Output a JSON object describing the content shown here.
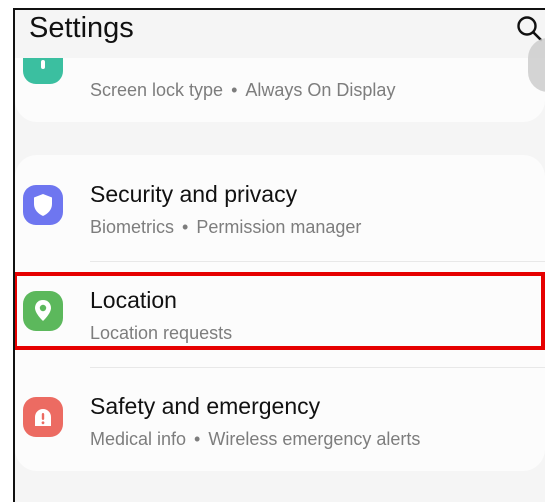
{
  "header": {
    "title": "Settings",
    "search_icon": "search-icon"
  },
  "lock_screen": {
    "subtitle_parts": [
      "Screen lock type",
      "Always On Display"
    ],
    "icon": "lock-icon",
    "icon_color": "#3bbfa0"
  },
  "items": [
    {
      "title": "Security and privacy",
      "subtitle_parts": [
        "Biometrics",
        "Permission manager"
      ],
      "icon": "shield-icon",
      "icon_color": "#6e76f0"
    },
    {
      "title": "Location",
      "subtitle_parts": [
        "Location requests"
      ],
      "icon": "location-pin-icon",
      "icon_color": "#5cb85c",
      "highlighted": true
    },
    {
      "title": "Safety and emergency",
      "subtitle_parts": [
        "Medical info",
        "Wireless emergency alerts"
      ],
      "icon": "alert-icon",
      "icon_color": "#ec6b62"
    }
  ],
  "separator": "•",
  "highlight_color": "#e60000"
}
